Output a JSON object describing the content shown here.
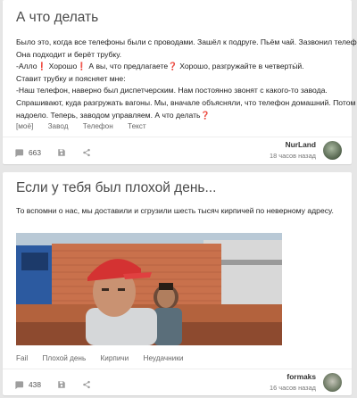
{
  "posts": [
    {
      "title": "А что делать",
      "lines": [
        "Было это, когда все телефоны были с проводами. Зашёл к подруге. Пьём чай. Зазвонил телефон.",
        "Она подходит и берёт трубку.",
        "-Алло❗ Хорошо❗ А вы, что предлагаете❓ Хорошо, разгружайте в четверты́й.",
        "Ставит трубку и поясняет мне:",
        "-Наш телефон, наверно был диспетчерским. Нам постоянно звонят с какого-то завода.",
        "Спрашивают, куда разгружать вагоны. Мы, вначале объясняли, что телефон домашний. Потом",
        "надоело. Теперь, заводом управляем. А что делать❓"
      ],
      "tags": [
        "[моё]",
        "Завод",
        "Телефон",
        "Текст"
      ],
      "comments": "663",
      "author": "NurLand",
      "time": "18 часов назад"
    },
    {
      "title": "Если у тебя был плохой день...",
      "lines": [
        "То вспомни о нас, мы доставили и сгрузили шесть тысяч кирпичей по неверному адресу."
      ],
      "tags": [
        "Fail",
        "Плохой день",
        "Кирпичи",
        "Неудачники"
      ],
      "comments": "438",
      "author": "formaks",
      "time": "16 часов назад"
    }
  ],
  "icons": {
    "comments": "comment-icon",
    "save": "save-icon",
    "share": "share-icon"
  },
  "colors": {
    "background": "#e6e6e6",
    "card": "#ffffff",
    "title": "#4a4a4a",
    "icon": "#9e9e9e"
  }
}
